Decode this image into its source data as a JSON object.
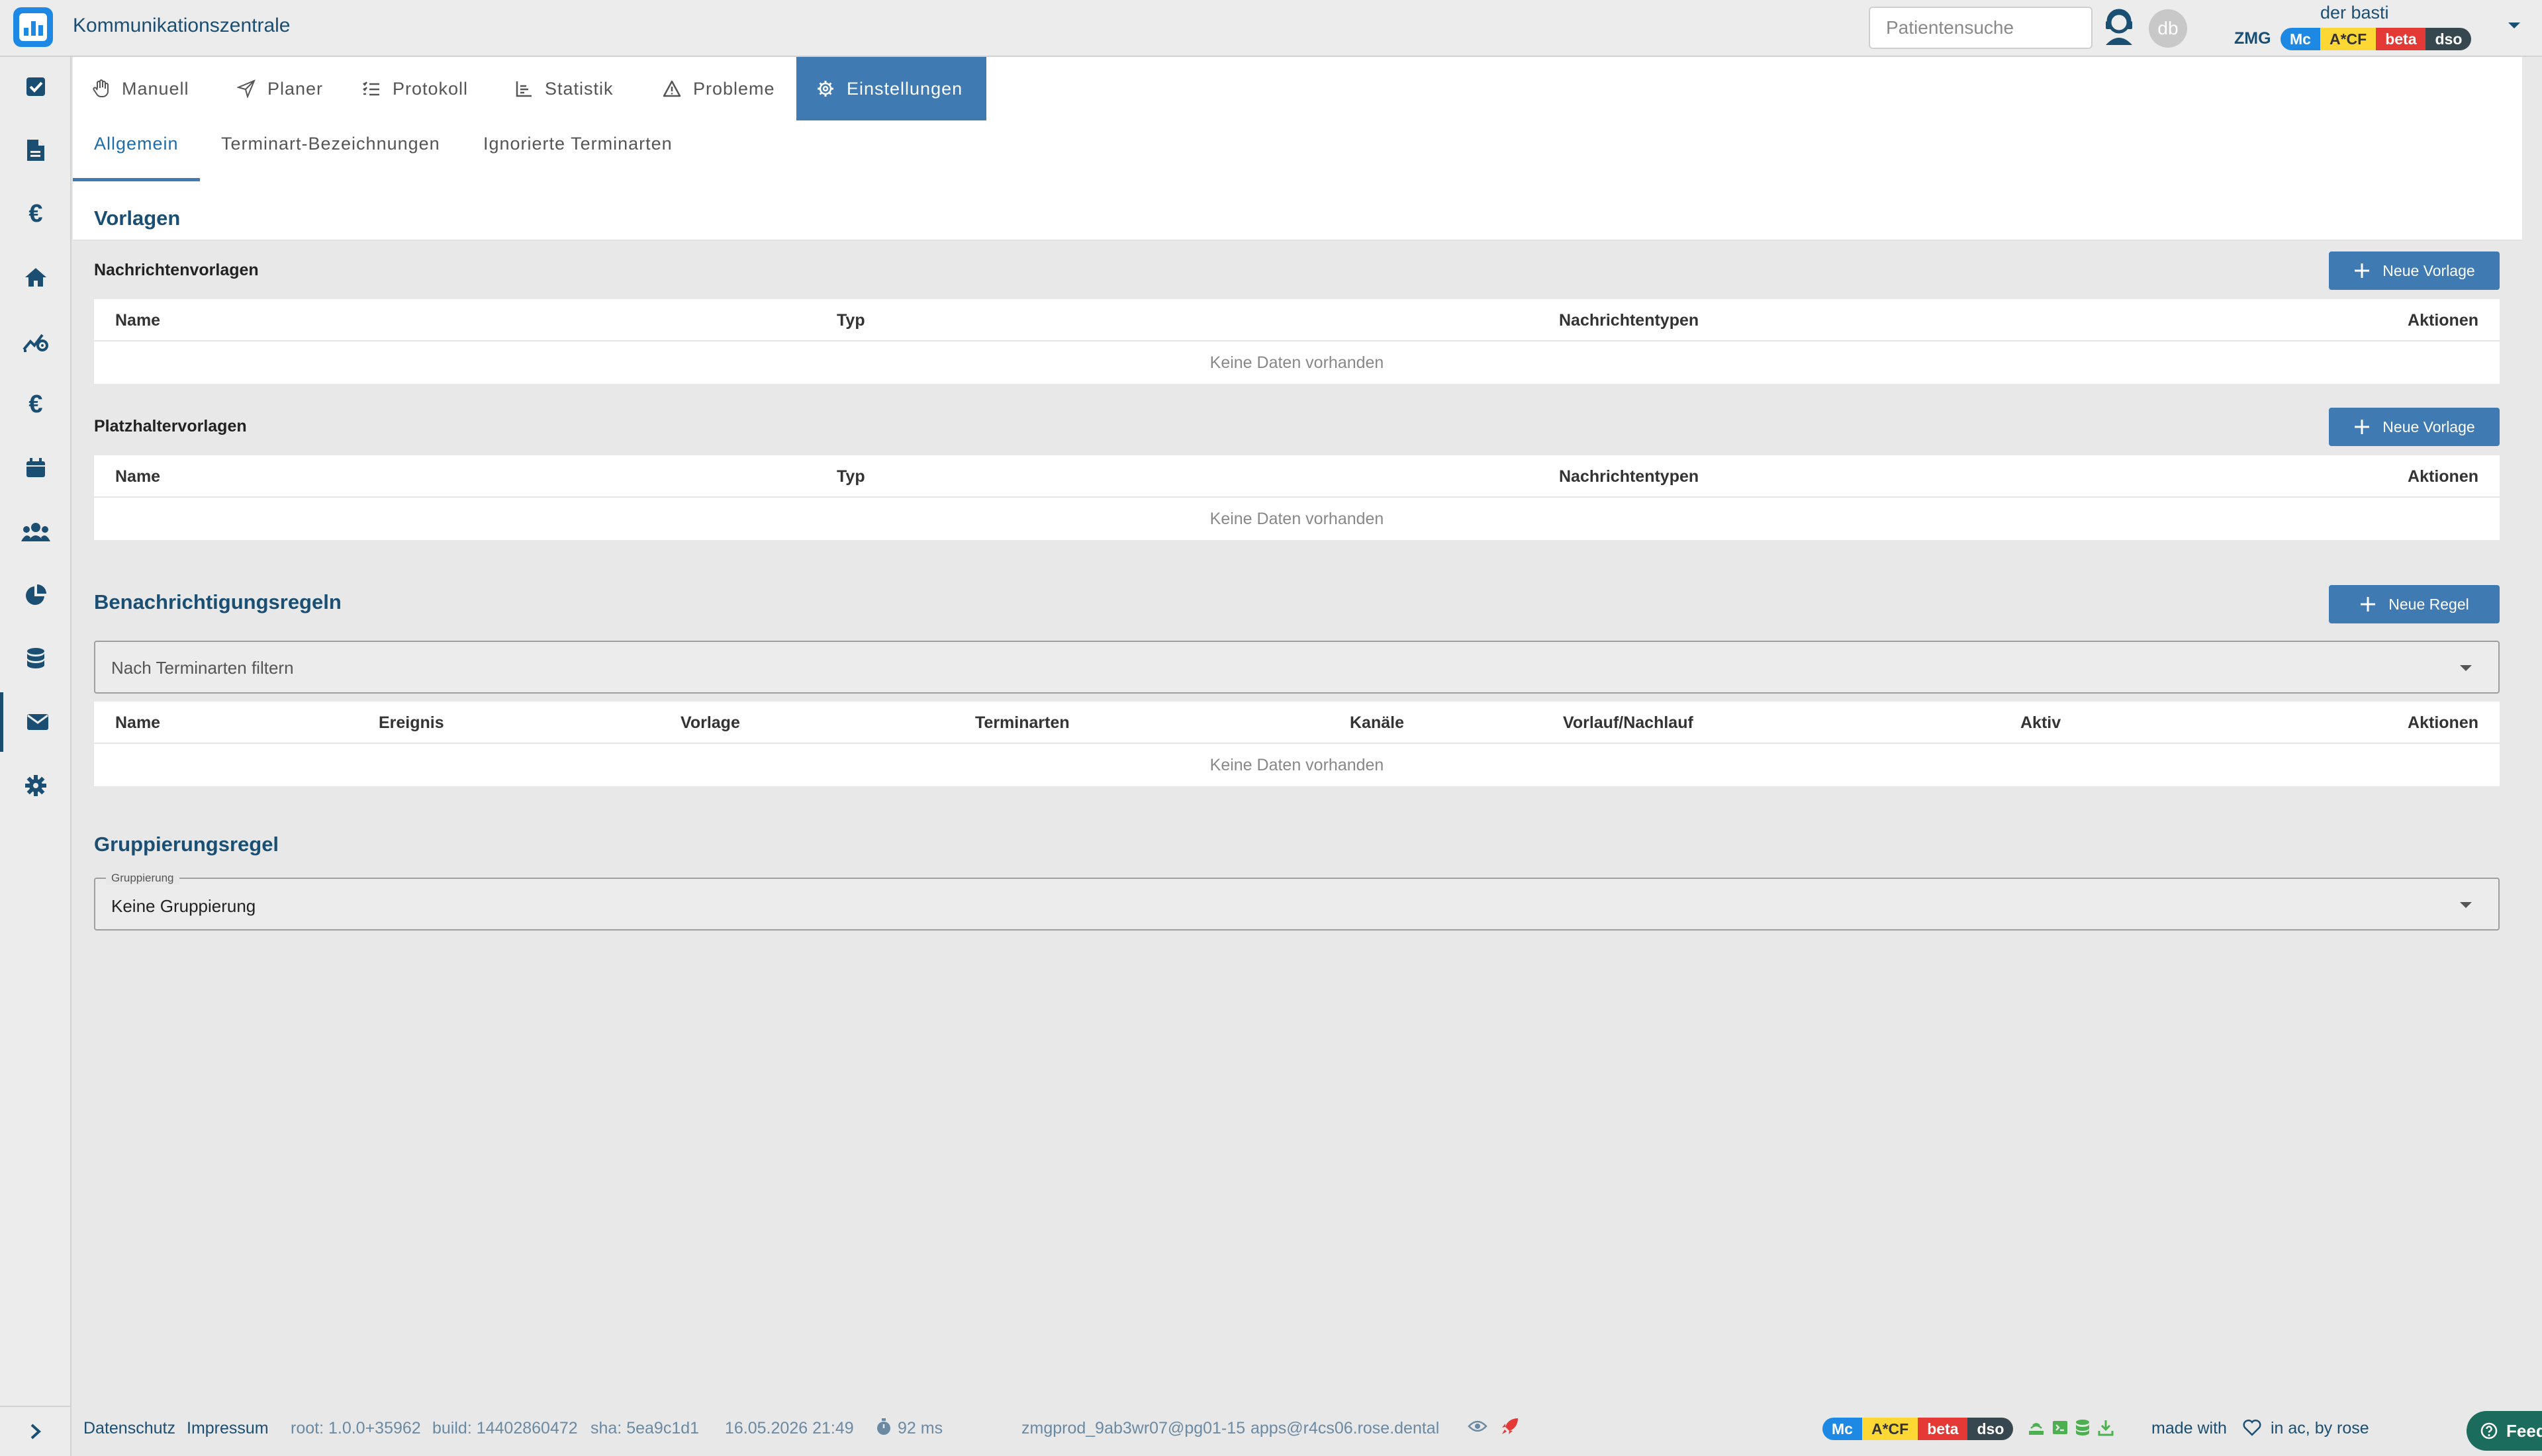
{
  "app": {
    "title": "Kommunikationszentrale"
  },
  "header": {
    "search_placeholder": "Patientensuche",
    "avatar_initials": "db",
    "user_name": "der basti",
    "org": "ZMG",
    "badges": [
      {
        "label": "Mc",
        "bg": "#1e88e5",
        "fg": "#ffffff"
      },
      {
        "label": "A*CF",
        "bg": "#fdd835",
        "fg": "#333333"
      },
      {
        "label": "beta",
        "bg": "#e53935",
        "fg": "#ffffff"
      },
      {
        "label": "dso",
        "bg": "#37474f",
        "fg": "#ffffff"
      }
    ]
  },
  "sidebar": {
    "items": [
      {
        "icon": "checkbox-icon"
      },
      {
        "icon": "document-icon"
      },
      {
        "icon": "euro-icon"
      },
      {
        "icon": "home-icon"
      },
      {
        "icon": "chart-settings-icon"
      },
      {
        "icon": "euro-icon"
      },
      {
        "icon": "calendar-icon"
      },
      {
        "icon": "users-icon"
      },
      {
        "icon": "pie-chart-icon"
      },
      {
        "icon": "database-icon"
      },
      {
        "icon": "mail-icon",
        "active": true
      },
      {
        "icon": "gear-icon"
      }
    ]
  },
  "tabs": {
    "primary": [
      "Manuell",
      "Planer",
      "Protokoll",
      "Statistik",
      "Probleme",
      "Einstellungen"
    ],
    "active_primary": "Einstellungen",
    "secondary": [
      "Allgemein",
      "Terminart-Bezeichnungen",
      "Ignorierte Terminarten"
    ],
    "active_secondary": "Allgemein"
  },
  "vorlagen": {
    "title": "Vorlagen",
    "nachrichten": {
      "title": "Nachrichtenvorlagen",
      "button": "Neue Vorlage",
      "columns": [
        "Name",
        "Typ",
        "Nachrichtentypen",
        "Aktionen"
      ],
      "empty": "Keine Daten vorhanden"
    },
    "platzhalter": {
      "title": "Platzhaltervorlagen",
      "button": "Neue Vorlage",
      "columns": [
        "Name",
        "Typ",
        "Nachrichtentypen",
        "Aktionen"
      ],
      "empty": "Keine Daten vorhanden"
    }
  },
  "regeln": {
    "title": "Benachrichtigungsregeln",
    "button": "Neue Regel",
    "filter_placeholder": "Nach Terminarten filtern",
    "columns": [
      "Name",
      "Ereignis",
      "Vorlage",
      "Terminarten",
      "Kanäle",
      "Vorlauf/Nachlauf",
      "Aktiv",
      "Aktionen"
    ],
    "empty": "Keine Daten vorhanden"
  },
  "gruppierung": {
    "title": "Gruppierungsregel",
    "field_label": "Gruppierung",
    "value": "Keine Gruppierung"
  },
  "footer": {
    "datenschutz": "Datenschutz",
    "impressum": "Impressum",
    "root": "root: 1.0.0+35962",
    "build": "build: 14402860472",
    "sha": "sha: 5ea9c1d1",
    "datetime": "16.05.2026 21:49",
    "latency": "92 ms",
    "db": "zmgprod_9ab3wr07@pg01-15",
    "server": "apps@r4cs06.rose.dental",
    "made_with": "made with",
    "by": "in ac, by rose",
    "feedback": "Feedback"
  }
}
